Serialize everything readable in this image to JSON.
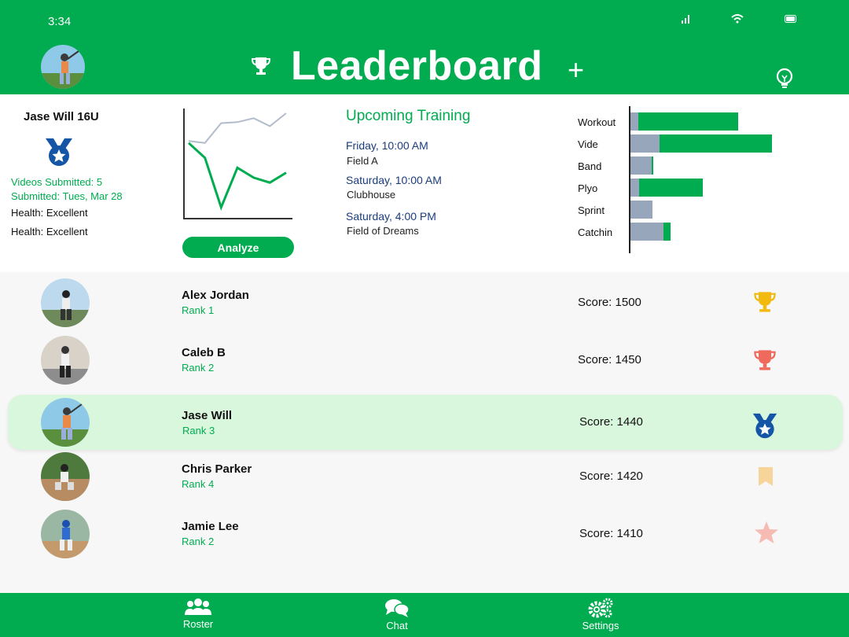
{
  "status": {
    "time": "3:34"
  },
  "header": {
    "title": "Leaderboard",
    "add": "+"
  },
  "profile": {
    "name": "Jase Will 16U",
    "videos_submitted": "Videos Submitted: 5",
    "submitted_date": "Submitted: Tues, Mar 28",
    "health_1_label": "Health:",
    "health_1_value": "Excellent",
    "health_2_label": "Health:",
    "health_2_value": "Excellent",
    "analyze_label": "Analyze"
  },
  "training": {
    "title": "Upcoming Training",
    "sessions": [
      {
        "when": "Friday, 10:00 AM",
        "where": "Field A"
      },
      {
        "when": "Saturday, 10:00 AM",
        "where": "Clubhouse"
      },
      {
        "when": "Saturday, 4:00 PM",
        "where": "Field of Dreams"
      }
    ]
  },
  "leaderboard": [
    {
      "name": "Alex Jordan",
      "rank": "Rank 1",
      "score": "Score: 1500",
      "icon": "gold-trophy-icon"
    },
    {
      "name": "Caleb B",
      "rank": "Rank 2",
      "score": "Score: 1450",
      "icon": "red-trophy-icon"
    },
    {
      "name": "Jase Will",
      "rank": "Rank 3",
      "score": "Score: 1440",
      "icon": "blue-medal-icon"
    },
    {
      "name": "Chris Parker",
      "rank": "Rank 4",
      "score": "Score: 1420",
      "icon": "bookmark-icon"
    },
    {
      "name": "Jamie Lee",
      "rank": "Rank 2",
      "score": "Score: 1410",
      "icon": "star-icon"
    }
  ],
  "nav": {
    "roster": "Roster",
    "chat": "Chat",
    "settings": "Settings"
  },
  "colors": {
    "brand": "#00ac4f",
    "highlight": "#d9f7dd",
    "navy": "#1a3d7c",
    "gray_series": "#97a6bb"
  },
  "chart_data": [
    {
      "type": "line",
      "title": "",
      "xlabel": "",
      "ylabel": "",
      "x": [
        1,
        2,
        3,
        4,
        5,
        6,
        7
      ],
      "series": [
        {
          "values": [
            72,
            70,
            90,
            91,
            95,
            87,
            100
          ]
        },
        {
          "values": [
            70,
            55,
            5,
            45,
            35,
            30,
            40
          ]
        }
      ],
      "ylim": [
        0,
        100
      ]
    },
    {
      "type": "bar",
      "orientation": "horizontal",
      "stacked": true,
      "categories": [
        "Workout",
        "Vide",
        "Band",
        "Plyo",
        "Sprint",
        "Catchin"
      ],
      "series": [
        {
          "values": [
            10,
            37,
            27,
            11,
            28,
            42
          ]
        },
        {
          "values": [
            127,
            143,
            2,
            81,
            0,
            9
          ]
        }
      ]
    }
  ]
}
